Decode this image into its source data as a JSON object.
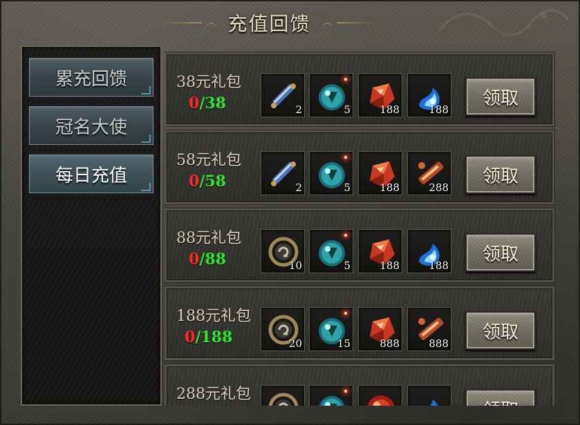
{
  "window": {
    "title": "充值回馈"
  },
  "nav": {
    "items": [
      {
        "label": "累充回馈"
      },
      {
        "label": "冠名大使"
      },
      {
        "label": "每日充值"
      }
    ],
    "active_index": 2
  },
  "packages": [
    {
      "name": "38元礼包",
      "progress_current": "0",
      "progress_rest": "/38",
      "items": [
        {
          "icon": "scroll-icon",
          "count": "2"
        },
        {
          "icon": "green-orb-icon",
          "count": "5"
        },
        {
          "icon": "red-gem-icon",
          "count": "188"
        },
        {
          "icon": "blue-flame-icon",
          "count": "188"
        }
      ],
      "button": "领取"
    },
    {
      "name": "58元礼包",
      "progress_current": "0",
      "progress_rest": "/58",
      "items": [
        {
          "icon": "scroll-icon",
          "count": "2"
        },
        {
          "icon": "green-orb-icon",
          "count": "5"
        },
        {
          "icon": "red-gem-icon",
          "count": "188"
        },
        {
          "icon": "fire-sword-icon",
          "count": "288"
        }
      ],
      "button": "领取"
    },
    {
      "name": "88元礼包",
      "progress_current": "0",
      "progress_rest": "/88",
      "items": [
        {
          "icon": "ring-icon",
          "count": "10"
        },
        {
          "icon": "green-orb-icon",
          "count": "5"
        },
        {
          "icon": "red-gem-icon",
          "count": "188"
        },
        {
          "icon": "blue-flame-icon",
          "count": "188"
        }
      ],
      "button": "领取"
    },
    {
      "name": "188元礼包",
      "progress_current": "0",
      "progress_rest": "/188",
      "items": [
        {
          "icon": "ring-icon",
          "count": "20"
        },
        {
          "icon": "green-orb-icon",
          "count": "15"
        },
        {
          "icon": "red-gem-icon",
          "count": "888"
        },
        {
          "icon": "fire-sword-icon",
          "count": "888"
        }
      ],
      "button": "领取"
    },
    {
      "name": "288元礼包",
      "progress_current": "",
      "progress_rest": "",
      "items": [
        {
          "icon": "ring-icon",
          "count": ""
        },
        {
          "icon": "green-orb-icon",
          "count": ""
        },
        {
          "icon": "red-ball-icon",
          "count": ""
        },
        {
          "icon": "blue-flame-icon",
          "count": ""
        }
      ],
      "button": "领取"
    }
  ]
}
